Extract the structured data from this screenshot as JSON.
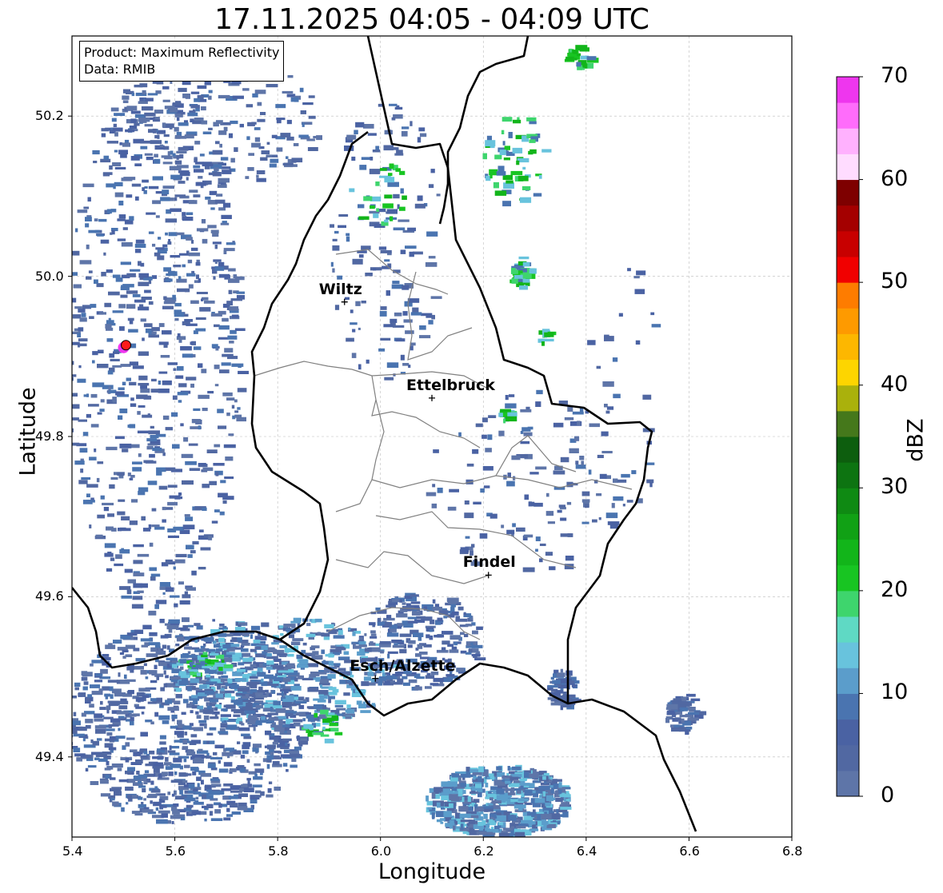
{
  "title": "17.11.2025 04:05 - 04:09 UTC",
  "info": {
    "product": "Product: Maximum Reflectivity",
    "data_source": "Data: RMIB"
  },
  "axes": {
    "xlabel": "Longitude",
    "ylabel": "Latitude",
    "xlim": [
      5.4,
      6.8
    ],
    "ylim": [
      49.3,
      50.3
    ],
    "xticks": [
      "5.4",
      "5.6",
      "5.8",
      "6.0",
      "6.2",
      "6.4",
      "6.6",
      "6.8"
    ],
    "yticks": [
      "49.4",
      "49.6",
      "49.8",
      "50.0",
      "50.2"
    ],
    "grid": true
  },
  "colorbar": {
    "label": "dBZ",
    "ticks": [
      "0",
      "10",
      "20",
      "30",
      "40",
      "50",
      "60",
      "70"
    ],
    "range": [
      0,
      70
    ],
    "colors": [
      "#5e75a8",
      "#5168a2",
      "#4a62a3",
      "#4a74b0",
      "#5b9dcb",
      "#68c3dd",
      "#5fd9c4",
      "#3ed56d",
      "#18c522",
      "#12b51a",
      "#11a115",
      "#0f8a13",
      "#0d7411",
      "#0d5e0e",
      "#45781b",
      "#aab10c",
      "#fdd500",
      "#fdb700",
      "#fe9a00",
      "#fe7c00",
      "#f10000",
      "#c80000",
      "#a40000",
      "#7e0000",
      "#ffdcff",
      "#ffb1fe",
      "#ff6cfb",
      "#ee36ee"
    ]
  },
  "cities": [
    {
      "name": "Wiltz",
      "lon": 5.93,
      "lat": 49.968
    },
    {
      "name": "Ettelbruck",
      "lon": 6.1,
      "lat": 49.848
    },
    {
      "name": "Findel",
      "lon": 6.21,
      "lat": 49.627
    },
    {
      "name": "Esch/Alzette",
      "lon": 5.99,
      "lat": 49.498
    }
  ],
  "radar_site": {
    "lon": 5.505,
    "lat": 49.914
  },
  "legend_colors": {
    "border": "#000000",
    "admin": "#808080",
    "grid": "#bbbbbb",
    "marker": "#ff1a1a"
  }
}
